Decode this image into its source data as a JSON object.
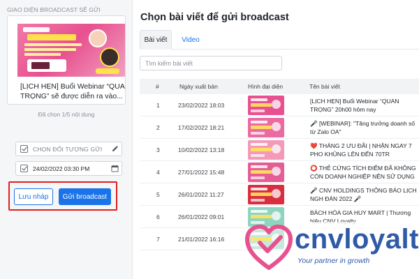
{
  "left_panel": {
    "title": "GIAO DIỆN BROADCAST SẼ GỬI",
    "preview": {
      "text": "[LỊCH HẸN] Buổi Webinar “QUAN TRỌNG” sẽ được diễn ra vào..."
    },
    "selected_count": "Đã chọn 1/5 nội dung",
    "target_field": {
      "label": "CHỌN ĐỐI TƯỢNG GỬI",
      "checked": true,
      "icon": "pencil-icon"
    },
    "date_field": {
      "value": "24/02/2022 03:30 PM",
      "checked": true,
      "icon": "calendar-icon"
    },
    "buttons": {
      "draft": "Lưu nháp",
      "send": "Gửi broadcast"
    }
  },
  "main": {
    "title": "Chọn bài viết để gửi broadcast",
    "tabs": [
      {
        "label": "Bài viết",
        "active": true
      },
      {
        "label": "Video",
        "active": false
      }
    ],
    "search": {
      "placeholder": "Tìm kiếm bài viết",
      "value": ""
    },
    "table": {
      "headers": {
        "no": "#",
        "date": "Ngày xuất bản",
        "thumb": "Hình đại diện",
        "name": "Tên bài viết"
      },
      "rows": [
        {
          "no": "1",
          "date": "23/02/2022 18:03",
          "name": "[LỊCH HẸN] Buổi Webinar “QUAN TRỌNG” 20h00 hôm nay",
          "thumb_color": "#e8518f"
        },
        {
          "no": "2",
          "date": "17/02/2022 18:21",
          "name": "🎤 [WEBINAR]: \"Tăng trưởng doanh số từ Zalo OA\"",
          "thumb_color": "#ec6aa1"
        },
        {
          "no": "3",
          "date": "10/02/2022 13:18",
          "name": "❤️ THÁNG 2 ƯU ĐÃI | NHẬN NGAY 7 PHO KHỦNG LÊN ĐẾN 70TR",
          "thumb_color": "#f29ab8"
        },
        {
          "no": "4",
          "date": "27/01/2022 15:48",
          "name": "⭕ THẺ CỨNG TÍCH ĐIỂM ĐÃ KHÔNG CÒN DOANH NGHIỆP NÊN SỬ DỤNG GIẢI PHÁP",
          "thumb_color": "#e55d95"
        },
        {
          "no": "5",
          "date": "26/01/2022 11:27",
          "name": "🎤 CNV HOLDINGS THÔNG BÁO LỊCH NGH ĐÁN 2022 🎤",
          "thumb_color": "#d92e3f"
        },
        {
          "no": "6",
          "date": "26/01/2022 09:01",
          "name": "BÁCH HÓA GIA HUY MART | Thương hiệu CNV Loyalty",
          "thumb_color": "#8fd4c0"
        },
        {
          "no": "7",
          "date": "21/01/2022 16:16",
          "name": "",
          "thumb_color": "#c9e8dc"
        }
      ]
    }
  },
  "watermark": {
    "brand": "cnvloyalty",
    "tagline": "Your partner in growth",
    "heart_color": "#e8518f",
    "text_color": "#2f5aa8"
  }
}
